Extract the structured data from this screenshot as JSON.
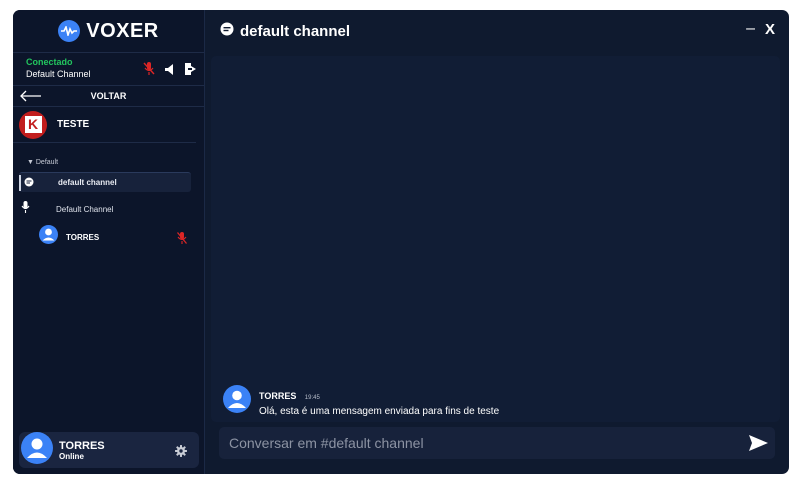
{
  "app": {
    "name": "VOXER"
  },
  "connection": {
    "status": "Conectado",
    "channel": "Default Channel",
    "status_color": "#22c55e"
  },
  "nav": {
    "back_label": "VOLTAR"
  },
  "server": {
    "name": "TESTE",
    "icon_letter": "K",
    "icon_color": "#c21d1d"
  },
  "channels": {
    "category": "▼ Default",
    "text_channel": "default channel",
    "voice_channel": "Default Channel",
    "voice_members": [
      {
        "name": "TORRES",
        "muted": true
      }
    ]
  },
  "user": {
    "name": "TORRES",
    "status": "Online"
  },
  "header": {
    "channel_title": "default channel",
    "minimize": "–",
    "close": "X"
  },
  "messages": [
    {
      "author": "TORRES",
      "time": "19:45",
      "text": "Olá, esta é uma mensagem enviada para fins de teste"
    }
  ],
  "composer": {
    "placeholder": "Conversar em #default channel",
    "value": ""
  },
  "icons": {
    "logo": "soundwave-icon",
    "mic_muted": "mic-off-icon",
    "speaker": "speaker-icon",
    "disconnect": "exit-icon",
    "back": "arrow-left-icon",
    "text_channel": "chat-bubble-icon",
    "voice_channel": "microphone-icon",
    "settings": "gear-icon",
    "send": "send-icon"
  },
  "colors": {
    "accent": "#3b82f6",
    "muted_red": "#dc2626",
    "background": "#0f1a2f"
  }
}
